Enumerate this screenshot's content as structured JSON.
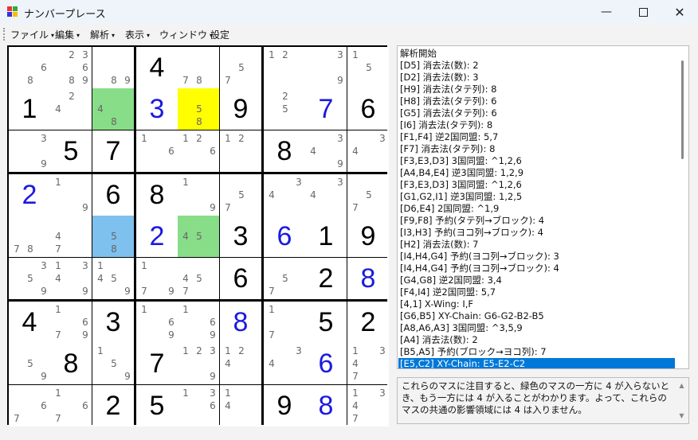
{
  "window": {
    "title": "ナンバープレース",
    "min_icon": "minimize-icon",
    "max_icon": "maximize-icon",
    "close_icon": "close-icon"
  },
  "menu": [
    {
      "label": "ファイル",
      "dropdown": true
    },
    {
      "label": "編集",
      "dropdown": true
    },
    {
      "label": "解析",
      "dropdown": true
    },
    {
      "label": "表示",
      "dropdown": true
    },
    {
      "label": "ウィンドウ",
      "dropdown": true
    },
    {
      "label": "設定",
      "dropdown": false
    }
  ],
  "colors": {
    "given": "#000000",
    "solved": "#1a1ae0",
    "candidate": "#666666",
    "green": "#88dd88",
    "yellow": "#ffff00",
    "blue": "#7ec0ee",
    "selected": "#0078d7"
  },
  "board": [
    [
      {
        "c": [
          6,
          8
        ]
      },
      {
        "c": [
          2,
          3,
          6,
          9,
          8
        ]
      },
      {
        "c": [
          8,
          9
        ]
      },
      {
        "v": 4,
        "k": "given"
      },
      {
        "c": [
          7,
          8
        ]
      },
      {
        "c": [
          5,
          7
        ]
      },
      {
        "c": [
          1,
          2
        ]
      },
      {
        "c": [
          3,
          9
        ]
      },
      {
        "c": [
          1,
          5
        ]
      }
    ],
    [
      {
        "v": 1,
        "k": "given"
      },
      {
        "c": [
          2,
          4
        ]
      },
      {
        "c": [
          4,
          8
        ],
        "bg": "green"
      },
      {
        "v": 3,
        "k": "solved"
      },
      {
        "c": [
          5,
          8
        ],
        "bg": "yellow"
      },
      {
        "v": 9,
        "k": "given"
      },
      {
        "c": [
          2,
          5
        ]
      },
      {
        "v": 7,
        "k": "solved"
      },
      {
        "v": 6,
        "k": "given"
      }
    ],
    [
      {
        "c": [
          3,
          9
        ]
      },
      {
        "v": 5,
        "k": "given"
      },
      {
        "v": 7,
        "k": "given"
      },
      {
        "c": [
          1,
          6
        ]
      },
      {
        "c": [
          1,
          2,
          6
        ]
      },
      {
        "c": [
          1,
          2
        ]
      },
      {
        "v": 8,
        "k": "given"
      },
      {
        "c": [
          3,
          4,
          9
        ]
      },
      {
        "c": [
          3,
          4
        ]
      }
    ],
    [
      {
        "v": 2,
        "k": "solved"
      },
      {
        "c": [
          1,
          9
        ]
      },
      {
        "v": 6,
        "k": "given"
      },
      {
        "v": 8,
        "k": "given"
      },
      {
        "c": [
          1,
          9
        ]
      },
      {
        "c": [
          5,
          7
        ]
      },
      {
        "c": [
          3,
          4
        ]
      },
      {
        "c": [
          3,
          4
        ]
      },
      {
        "c": [
          5,
          7
        ]
      }
    ],
    [
      {
        "c": [
          7,
          8
        ]
      },
      {
        "c": [
          4,
          7
        ]
      },
      {
        "c": [
          5,
          8
        ],
        "bg": "blue"
      },
      {
        "v": 2,
        "k": "solved"
      },
      {
        "c": [
          4,
          5
        ],
        "bg": "green"
      },
      {
        "v": 3,
        "k": "given"
      },
      {
        "v": 6,
        "k": "solved"
      },
      {
        "v": 1,
        "k": "given"
      },
      {
        "v": 9,
        "k": "given"
      }
    ],
    [
      {
        "c": [
          3,
          5,
          9
        ]
      },
      {
        "c": [
          1,
          3,
          4,
          9
        ]
      },
      {
        "c": [
          1,
          4,
          5,
          9
        ]
      },
      {
        "c": [
          1,
          9,
          7
        ]
      },
      {
        "c": [
          4,
          5,
          7
        ]
      },
      {
        "v": 6,
        "k": "given"
      },
      {
        "c": [
          5,
          7
        ]
      },
      {
        "v": 2,
        "k": "given"
      },
      {
        "v": 8,
        "k": "solved"
      }
    ],
    [
      {
        "v": 4,
        "k": "given"
      },
      {
        "c": [
          1,
          6,
          7,
          9
        ]
      },
      {
        "v": 3,
        "k": "given"
      },
      {
        "c": [
          1,
          6,
          9
        ]
      },
      {
        "c": [
          1,
          6,
          9
        ]
      },
      {
        "v": 8,
        "k": "solved"
      },
      {
        "c": [
          1,
          7
        ]
      },
      {
        "v": 5,
        "k": "given"
      },
      {
        "v": 2,
        "k": "given"
      }
    ],
    [
      {
        "c": [
          5,
          9
        ]
      },
      {
        "v": 8,
        "k": "given"
      },
      {
        "c": [
          1,
          5,
          9
        ]
      },
      {
        "v": 7,
        "k": "given"
      },
      {
        "c": [
          1,
          2,
          3,
          9
        ]
      },
      {
        "c": [
          1,
          2,
          4
        ]
      },
      {
        "c": [
          3,
          4
        ]
      },
      {
        "v": 6,
        "k": "solved"
      },
      {
        "c": [
          1,
          3,
          4,
          7
        ]
      }
    ],
    [
      {
        "c": [
          6,
          7
        ]
      },
      {
        "c": [
          1,
          6,
          7
        ]
      },
      {
        "v": 2,
        "k": "given"
      },
      {
        "v": 5,
        "k": "given"
      },
      {
        "c": [
          1,
          3,
          6
        ]
      },
      {
        "c": [
          1,
          4
        ]
      },
      {
        "v": 9,
        "k": "given"
      },
      {
        "v": 8,
        "k": "solved"
      },
      {
        "c": [
          1,
          3,
          4,
          7
        ]
      }
    ]
  ],
  "log": {
    "lines": [
      "解析開始",
      "[D5] 消去法(数): 2",
      "[D2] 消去法(数): 3",
      "[H9] 消去法(タテ列): 8",
      "[H8] 消去法(タテ列): 6",
      "[G5] 消去法(タテ列): 6",
      "[I6] 消去法(タテ列): 8",
      "[F1,F4] 逆2国同盟: 5,7",
      "[F7] 消去法(タテ列): 8",
      "[F3,E3,D3] 3国同盟: ^1,2,6",
      "[A4,B4,E4] 逆3国同盟: 1,2,9",
      "[F3,E3,D3] 3国同盟: ^1,2,6",
      "[G1,G2,I1] 逆3国同盟: 1,2,5",
      "[D6,E4] 2国同盟: ^1,9",
      "[F9,F8] 予約(タテ列→ブロック): 4",
      "[I3,H3] 予約(ヨコ列→ブロック): 4",
      "[H2] 消去法(数): 7",
      "[I4,H4,G4] 予約(ヨコ列→ブロック): 3",
      "[I4,H4,G4] 予約(ヨコ列→ブロック): 4",
      "[G4,G8] 逆2国同盟: 3,4",
      "[F4,I4] 逆2国同盟: 5,7",
      "[4,1] X-Wing: I,F",
      "[G6,B5] XY-Chain: G6-G2-B2-B5",
      "[A8,A6,A3] 3国同盟: ^3,5,9",
      "[A4] 消去法(数): 2",
      "[B5,A5] 予約(ブロック→ヨコ列): 7",
      "[E5,C2] XY-Chain: E5-E2-C2"
    ],
    "selected_index": 26
  },
  "description": "これらのマスに注目すると、緑色のマスの一方に 4 が入らないとき、もう一方には 4 が入ることがわかります。よって、これらのマスの共通の影響領域には 4 は入りません。"
}
